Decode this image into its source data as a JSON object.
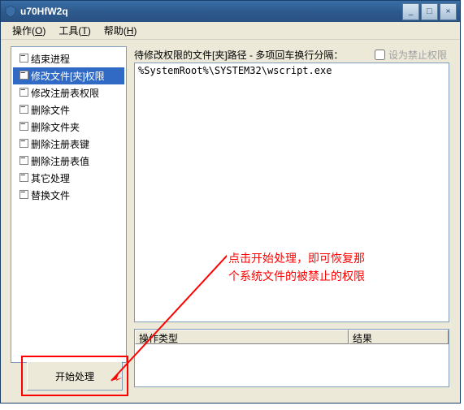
{
  "window": {
    "title": "u70HfW2q"
  },
  "menu": {
    "operations": "操作",
    "operations_key": "O",
    "tools": "工具",
    "tools_key": "T",
    "help": "帮助",
    "help_key": "H"
  },
  "tree": {
    "items": [
      "结束进程",
      "修改文件[夹]权限",
      "修改注册表权限",
      "删除文件",
      "删除文件夹",
      "删除注册表键",
      "删除注册表值",
      "其它处理",
      "替换文件"
    ],
    "selected_index": 1
  },
  "top_label": "待修改权限的文件[夹]路径 - 多项回车换行分隔：",
  "checkbox_label": "设为禁止权限",
  "textarea_value": "%SystemRoot%\\SYSTEM32\\wscript.exe",
  "annotation_text": "点击开始处理，即可恢复那个系统文件的被禁止的权限",
  "table": {
    "col1": "操作类型",
    "col2": "结果"
  },
  "start_button": "开始处理"
}
